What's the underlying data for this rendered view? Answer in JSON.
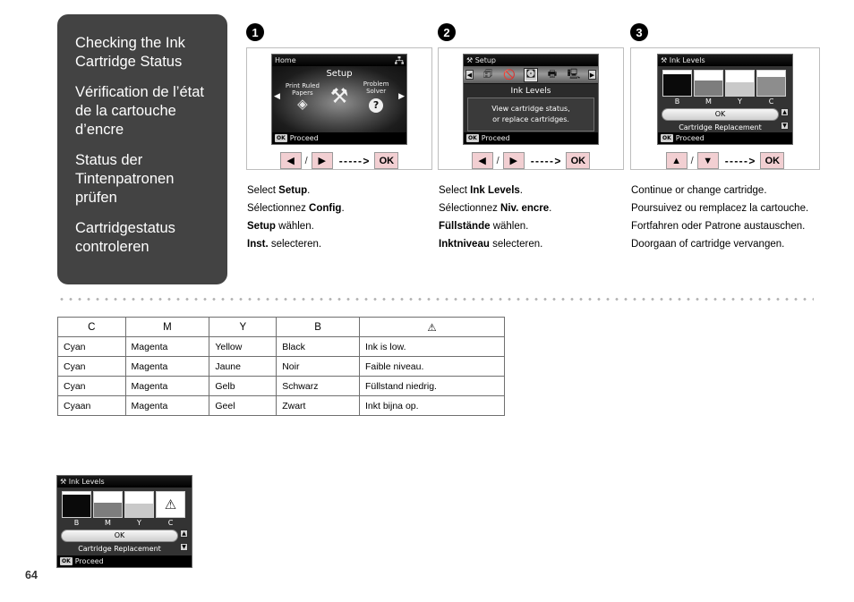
{
  "sidebar": {
    "headings": [
      "Checking the Ink Cartridge Status",
      "Vérification de l’état de la cartouche d’encre",
      "Status der Tintenpatronen prüfen",
      "Cartridgestatus controleren"
    ]
  },
  "steps": [
    {
      "badge": "1",
      "lcd": {
        "title": "Home",
        "net_icon": "network-icon",
        "screen_label": "Setup",
        "left_label": "Print Ruled Papers",
        "right_label": "Problem Solver",
        "left_arrow": "◀",
        "right_arrow": "▶",
        "footer_chip": "OK",
        "footer_text": "Proceed"
      },
      "keys": {
        "first": "◀",
        "slash": "/",
        "second": "▶",
        "dash": "- - - - - >",
        "ok": "OK"
      },
      "instructions": [
        {
          "pre": "Select ",
          "bold": "Setup",
          "post": "."
        },
        {
          "pre": "Sélectionnez ",
          "bold": "Config",
          "post": "."
        },
        {
          "pre": "",
          "bold": "Setup",
          "post": " wählen."
        },
        {
          "pre": "",
          "bold": "Inst.",
          "post": " selecteren."
        }
      ]
    },
    {
      "badge": "2",
      "lcd": {
        "title": "Setup",
        "title_icon": "setup-tools-icon",
        "icons": [
          "left-arrow",
          "paper-icon",
          "cancel-icon",
          "ink-levels-icon",
          "printer-icon",
          "maintenance-icon",
          "right-arrow"
        ],
        "selected_icon_index": 3,
        "menu_name": "Ink Levels",
        "description_line1": "View cartridge status,",
        "description_line2": "or replace cartridges.",
        "footer_chip": "OK",
        "footer_text": "Proceed"
      },
      "keys": {
        "first": "◀",
        "slash": "/",
        "second": "▶",
        "dash": "- - - - - >",
        "ok": "OK"
      },
      "instructions": [
        {
          "pre": "Select ",
          "bold": "Ink Levels",
          "post": "."
        },
        {
          "pre": "Sélectionnez ",
          "bold": "Niv. encre",
          "post": "."
        },
        {
          "pre": "",
          "bold": "Füllstände",
          "post": " wählen."
        },
        {
          "pre": "",
          "bold": "Inktniveau",
          "post": " selecteren."
        }
      ]
    },
    {
      "badge": "3",
      "lcd": {
        "title": "Ink Levels",
        "title_icon": "setup-tools-icon",
        "cartridges": [
          {
            "label": "B",
            "level": 85,
            "color": "#0a0a0a",
            "warning": false
          },
          {
            "label": "M",
            "level": 60,
            "color": "#7d7d7d",
            "warning": false
          },
          {
            "label": "Y",
            "level": 55,
            "color": "#c9c9c9",
            "warning": false
          },
          {
            "label": "C",
            "level": 75,
            "color": "#8d8d8d",
            "warning": false
          }
        ],
        "ok_label": "OK",
        "replace_label": "Cartridge Replacement",
        "scroll_up": "▲",
        "scroll_down": "▼",
        "footer_chip": "OK",
        "footer_text": "Proceed"
      },
      "keys": {
        "first": "▲",
        "slash": "/",
        "second": "▼",
        "dash": "- - - - - >",
        "ok": "OK"
      },
      "instructions": [
        {
          "pre": "Continue or change cartridge.",
          "bold": "",
          "post": ""
        },
        {
          "pre": "Poursuivez ou remplacez la cartouche.",
          "bold": "",
          "post": ""
        },
        {
          "pre": "Fortfahren oder Patrone austauschen.",
          "bold": "",
          "post": ""
        },
        {
          "pre": "Doorgaan of cartridge vervangen.",
          "bold": "",
          "post": ""
        }
      ]
    }
  ],
  "table": {
    "headers": [
      "C",
      "M",
      "Y",
      "B",
      "⚠"
    ],
    "warning_header_icon": "warning-triangle-icon",
    "rows": [
      [
        "Cyan",
        "Magenta",
        "Yellow",
        "Black",
        "Ink is low."
      ],
      [
        "Cyan",
        "Magenta",
        "Jaune",
        "Noir",
        "Faible niveau."
      ],
      [
        "Cyan",
        "Magenta",
        "Gelb",
        "Schwarz",
        "Füllstand niedrig."
      ],
      [
        "Cyaan",
        "Magenta",
        "Geel",
        "Zwart",
        "Inkt bijna op."
      ]
    ]
  },
  "bottom_lcd": {
    "title": "Ink Levels",
    "title_icon": "setup-tools-icon",
    "cartridges": [
      {
        "label": "B",
        "level": 88,
        "color": "#0a0a0a",
        "warning": false
      },
      {
        "label": "M",
        "level": 58,
        "color": "#7d7d7d",
        "warning": false
      },
      {
        "label": "Y",
        "level": 52,
        "color": "#c9c9c9",
        "warning": false
      },
      {
        "label": "C",
        "level": 0,
        "color": "#ffffff",
        "warning": true
      }
    ],
    "ok_label": "OK",
    "replace_label": "Cartridge Replacement",
    "scroll_up": "▲",
    "scroll_down": "▼",
    "footer_chip": "OK",
    "footer_text": "Proceed"
  },
  "page_number": "64"
}
